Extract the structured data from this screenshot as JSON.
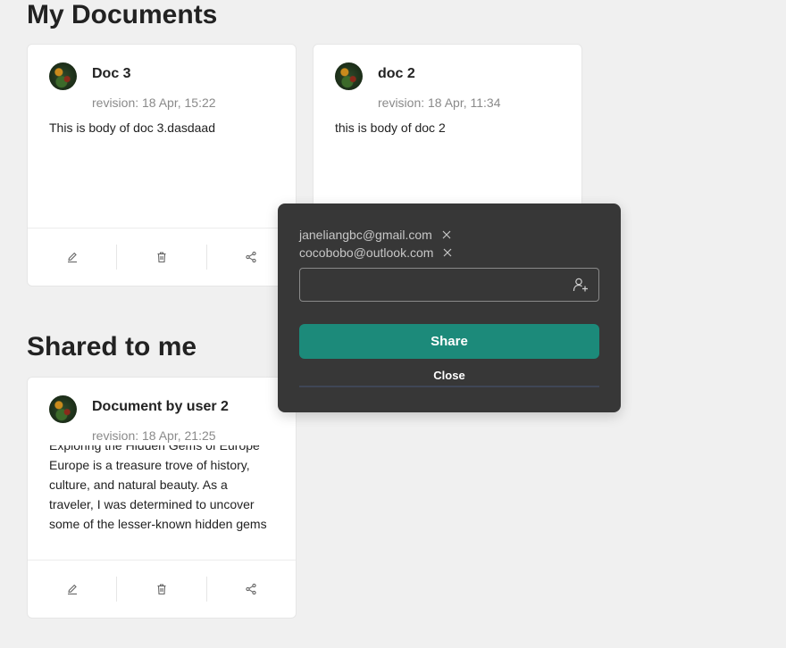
{
  "my_documents": {
    "title": "My Documents",
    "cards": [
      {
        "title": "Doc 3",
        "revision": "revision: 18 Apr, 15:22",
        "body": "This is body of doc 3.dasdaad"
      },
      {
        "title": "doc 2",
        "revision": "revision: 18 Apr, 11:34",
        "body": "this is body of doc 2"
      }
    ]
  },
  "shared_to_me": {
    "title": "Shared to me",
    "cards": [
      {
        "title": "Document by user 2",
        "revision": "revision: 18 Apr, 21:25",
        "body_lines": [
          "Exploring the Hidden Gems of Europe",
          "Europe is a treasure trove of history,",
          "culture, and natural beauty. As a",
          "traveler, I was determined to uncover",
          "some of the lesser-known hidden gems"
        ]
      }
    ]
  },
  "card_actions": [
    "edit-icon",
    "trash-icon",
    "share-icon"
  ],
  "share_popover": {
    "emails": [
      "janeliangbc@gmail.com",
      "cocobobo@outlook.com"
    ],
    "input_value": "",
    "share_label": "Share",
    "close_label": "Close"
  },
  "colors": {
    "background": "#f0f0f0",
    "popover": "#373737",
    "share_button": "#1c8a7a"
  }
}
